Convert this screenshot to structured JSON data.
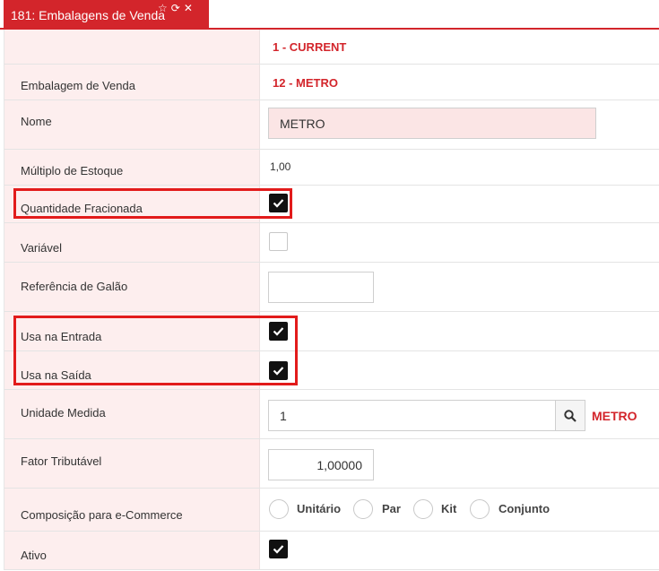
{
  "tab": {
    "title": "181: Embalagens de Venda"
  },
  "rows": {
    "header_value": "1 - CURRENT",
    "embalagem": {
      "label": "Embalagem de Venda",
      "value": "12 - METRO"
    },
    "nome": {
      "label": "Nome",
      "value": "METRO"
    },
    "multiplo": {
      "label": "Múltiplo de Estoque",
      "value": "1,00"
    },
    "quantidade": {
      "label": "Quantidade Fracionada",
      "checked": true
    },
    "variavel": {
      "label": "Variável",
      "checked": false
    },
    "referencia": {
      "label": "Referência de Galão",
      "value": ""
    },
    "entrada": {
      "label": "Usa na Entrada",
      "checked": true
    },
    "saida": {
      "label": "Usa na Saída",
      "checked": true
    },
    "unidade": {
      "label": "Unidade Medida",
      "value": "1",
      "desc": "METRO"
    },
    "fator": {
      "label": "Fator Tributável",
      "value": "1,00000"
    },
    "composicao": {
      "label": "Composição para e-Commerce",
      "options": [
        "Unitário",
        "Par",
        "Kit",
        "Conjunto"
      ],
      "selected": null
    },
    "ativo": {
      "label": "Ativo",
      "checked": true
    }
  },
  "icons": [
    "star-icon",
    "refresh-icon",
    "close-icon",
    "search-icon",
    "check-icon"
  ],
  "colors": {
    "accent": "#d3252b",
    "label_bg": "#fdeeee",
    "highlight": "#e21b1b"
  }
}
